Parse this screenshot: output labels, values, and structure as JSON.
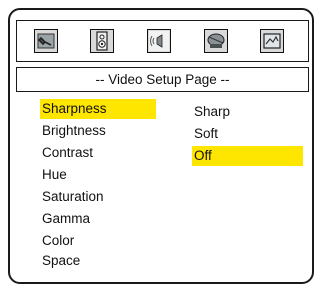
{
  "title": "-- Video Setup Page --",
  "icons": [
    "general-setup-icon",
    "speaker-setup-icon",
    "audio-setup-icon",
    "video-setup-icon",
    "preference-setup-icon"
  ],
  "menu": {
    "items": [
      "Sharpness",
      "Brightness",
      "Contrast",
      "Hue",
      "Saturation",
      "Gamma",
      "Color Space"
    ],
    "selected_index": 0
  },
  "options": {
    "items": [
      "Sharp",
      "Soft",
      "Off"
    ],
    "selected_index": 2
  },
  "colors": {
    "highlight": "#ffe600",
    "border": "#1a1a1a"
  }
}
